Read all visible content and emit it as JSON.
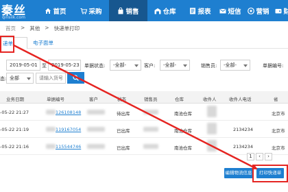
{
  "app": {
    "logo_main": "秦丝",
    "logo_sub": "qinsilk.com"
  },
  "nav": {
    "items": [
      {
        "label": "首页",
        "icon": "home-icon"
      },
      {
        "label": "采购",
        "icon": "cart-icon"
      },
      {
        "label": "销售",
        "icon": "bag-icon",
        "active": true
      },
      {
        "label": "仓库",
        "icon": "warehouse-icon"
      },
      {
        "label": "报表",
        "icon": "report-icon"
      },
      {
        "label": "短信",
        "icon": "sms-icon"
      },
      {
        "label": "营销",
        "icon": "marketing-icon"
      },
      {
        "label": "财务",
        "icon": "finance-icon"
      }
    ]
  },
  "breadcrumb": {
    "home": "首页",
    "sep1": ">",
    "level1": "其他",
    "sep2": ">",
    "current": "快递单打印"
  },
  "tabs": [
    {
      "label": "递单",
      "active": true
    },
    {
      "label": "电子面单"
    }
  ],
  "filters": {
    "date_from": "2019-05-01",
    "date_sep": "至",
    "date_to": "2019-05-23",
    "order_status_label": "单据状态:",
    "order_status_value": "-全部-",
    "customer_label": "客户:",
    "customer_value": "-全部-",
    "salesperson_label": "销售员:",
    "salesperson_value": "-全部-",
    "order_number_label": "单据编号:",
    "status_label": "态:",
    "status_value": "全部",
    "product_placeholder": "请输入货号"
  },
  "table": {
    "headers": [
      "业务日期",
      "单据编号",
      "客户",
      "状态",
      "销售员",
      "仓库",
      "收件人",
      "收件人电话",
      "省"
    ],
    "rows": [
      {
        "date": "-05-22 21:27",
        "order_no_suffix": "126108148",
        "status": "待出库",
        "warehouse": "南池仓库",
        "phone": "",
        "province": "北京市"
      },
      {
        "date": "-05-22 21:19",
        "order_no_suffix": "119167054",
        "status": "已出库",
        "warehouse": "南池仓库",
        "phone": "2134234",
        "province": "北京市"
      },
      {
        "date": "-05-22 21:16",
        "order_no_suffix": "115544746",
        "status": "已出库",
        "warehouse": "南池仓库",
        "phone": "2134234",
        "province": "北京市"
      }
    ]
  },
  "pager": {
    "current": "1",
    "prev": "‹",
    "next": "›"
  },
  "actions": {
    "edit_logistics": "编辑物流信息",
    "print_express": "打印快递单"
  },
  "colors": {
    "brand": "#1e7fd0",
    "nav_active": "#17578f",
    "highlight": "#e52421"
  }
}
